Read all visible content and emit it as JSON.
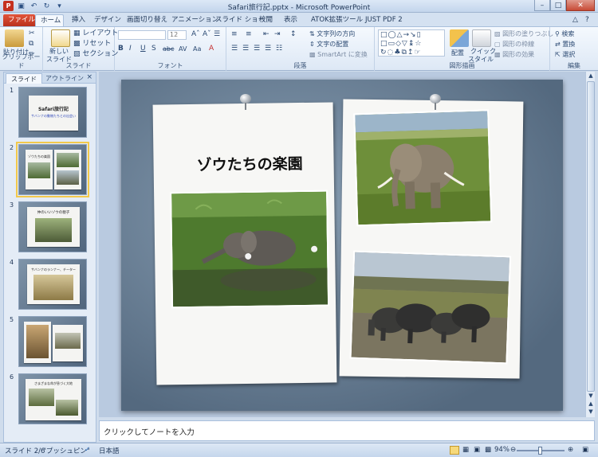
{
  "window": {
    "title": "Safari旅行記.pptx - Microsoft PowerPoint",
    "app_badge": "P"
  },
  "tabs": [
    "ファイル",
    "ホーム",
    "挿入",
    "デザイン",
    "画面切り替え",
    "アニメーション",
    "スライド ショー",
    "校閲",
    "表示",
    "ATOK拡張ツール",
    "JUST PDF 2"
  ],
  "ribbon": {
    "clipboard": {
      "label": "クリップボード",
      "paste": "貼り付け"
    },
    "slides": {
      "label": "スライド",
      "new_slide": "新しい",
      "new_slide2": "スライド",
      "layout": "レイアウト",
      "reset": "リセット",
      "section": "セクション"
    },
    "font": {
      "label": "フォント",
      "size": "12",
      "bold": "B",
      "italic": "I",
      "underline": "U",
      "strike": "S",
      "shadow": "abc",
      "spacing": "AV",
      "case": "Aa"
    },
    "paragraph": {
      "label": "段落",
      "text_direction": "文字列の方向",
      "align_text": "文字の配置",
      "smartart": "SmartArt に変換"
    },
    "drawing": {
      "label": "図形描画",
      "arrange": "配置",
      "quick_styles": "クイック",
      "quick_styles2": "スタイル",
      "fill": "図形の塗りつぶし",
      "outline": "図形の枠線",
      "effects": "図形の効果"
    },
    "editing": {
      "label": "編集",
      "find": "検索",
      "replace": "置換",
      "select": "選択"
    }
  },
  "pane": {
    "tab_slides": "スライド",
    "tab_outline": "アウトライン",
    "close": "×"
  },
  "thumbnails": [
    {
      "num": "1",
      "title": "Safari旅行記",
      "subtitle": "サバンナの動物たちとの出会い"
    },
    {
      "num": "2",
      "title": "ゾウたちの楽園",
      "selected": true
    },
    {
      "num": "3",
      "title": "仲のいいゾウの親子"
    },
    {
      "num": "4",
      "title": "サバンナのランナー、チーター"
    },
    {
      "num": "5",
      "title": ""
    },
    {
      "num": "6",
      "title": "さまざまな命が息づく大地"
    }
  ],
  "slide": {
    "title": "ゾウたちの楽園"
  },
  "notes": {
    "placeholder": "クリックしてノートを入力"
  },
  "status": {
    "slide_info": "スライド 2/6",
    "theme": "\"プッシュピン\"",
    "language": "日本語",
    "zoom": "94%"
  },
  "colors": {
    "accent": "#c5311f",
    "ribbon_bg": "#dde8f5",
    "frame": "#cfdcec"
  }
}
